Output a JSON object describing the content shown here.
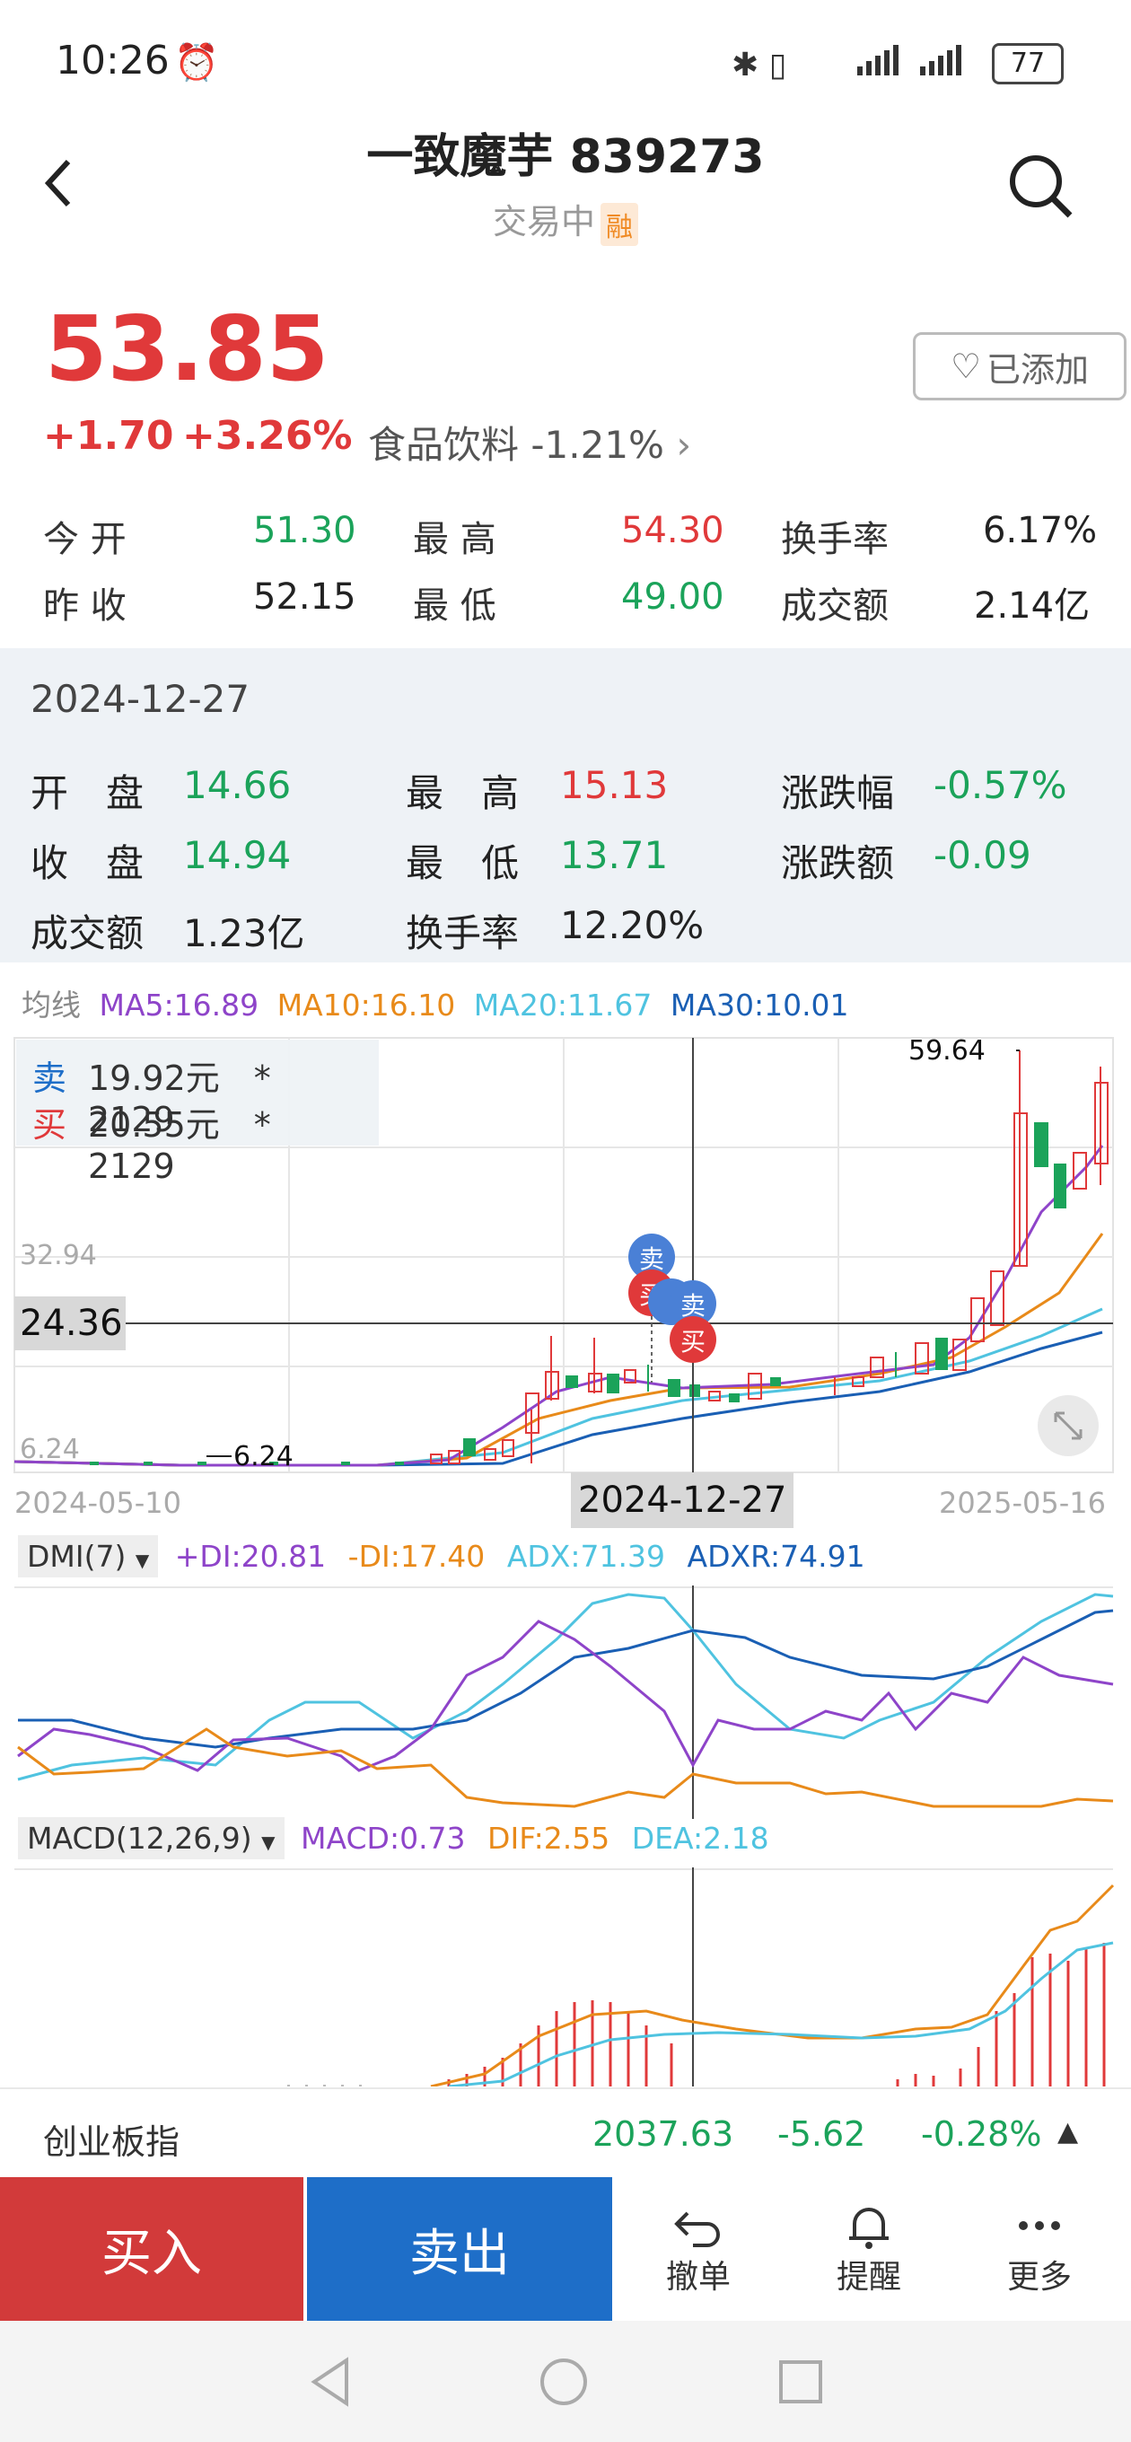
{
  "status_bar": {
    "time": "10:26",
    "battery": "77"
  },
  "header": {
    "title": "一致魔芋 839273",
    "status": "交易中",
    "badge": "融"
  },
  "quote": {
    "price": "53.85",
    "change": "+1.70",
    "change_pct": "+3.26%",
    "industry": "食品饮料",
    "industry_change": "-1.21%",
    "watch_label": "已添加"
  },
  "stats": {
    "open_label": "今 开",
    "open": "51.30",
    "high_label": "最 高",
    "high": "54.30",
    "turnover_label": "换手率",
    "turnover": "6.17%",
    "prev_close_label": "昨 收",
    "prev_close": "52.15",
    "low_label": "最 低",
    "low": "49.00",
    "amount_label": "成交额",
    "amount": "2.14亿"
  },
  "day_panel": {
    "date": "2024-12-27",
    "open_label": "开　盘",
    "open": "14.66",
    "high_label": "最　高",
    "high": "15.13",
    "pct_label": "涨跌幅",
    "pct": "-0.57%",
    "close_label": "收　盘",
    "close": "14.94",
    "low_label": "最　低",
    "low": "13.71",
    "amt_chg_label": "涨跌额",
    "amt_chg": "-0.09",
    "volume_label": "成交额",
    "volume": "1.23亿",
    "turnover_label": "换手率",
    "turnover": "12.20%"
  },
  "ma_legend": {
    "label": "均线",
    "ma5": "MA5:16.89",
    "ma10": "MA10:16.10",
    "ma20": "MA20:11.67",
    "ma30": "MA30:10.01"
  },
  "order_box": {
    "sell_label": "卖",
    "sell_text": "19.92元　*　2129",
    "buy_label": "买",
    "buy_text": "20.55元　*　2129"
  },
  "kline": {
    "max_label": "59.64",
    "min_label": "6.24",
    "y_label_1": "32.94",
    "y_label_2": "6.24",
    "crosshair_value": "24.36",
    "date_start": "2024-05-10",
    "date_cursor": "2024-12-27",
    "date_end": "2025-05-16",
    "marker_sell": "卖",
    "marker_buy": "买"
  },
  "dmi": {
    "selector": "DMI(7)",
    "pdi": "+DI:20.81",
    "mdi": "-DI:17.40",
    "adx": "ADX:71.39",
    "adxr": "ADXR:74.91"
  },
  "macd": {
    "selector": "MACD(12,26,9)",
    "macd": "MACD:0.73",
    "dif": "DIF:2.55",
    "dea": "DEA:2.18"
  },
  "index_bar": {
    "name": "创业板指",
    "value": "2037.63",
    "change": "-5.62",
    "change_pct": "-0.28%"
  },
  "actions": {
    "buy": "买入",
    "sell": "卖出",
    "cancel": "撤单",
    "alert": "提醒",
    "more": "更多"
  },
  "colors": {
    "red": "#e0393a",
    "green": "#1ba35a",
    "ma5": "#8e44c9",
    "ma10": "#e88a1a",
    "ma20": "#4fc3e0",
    "ma30": "#1a5fb4"
  }
}
